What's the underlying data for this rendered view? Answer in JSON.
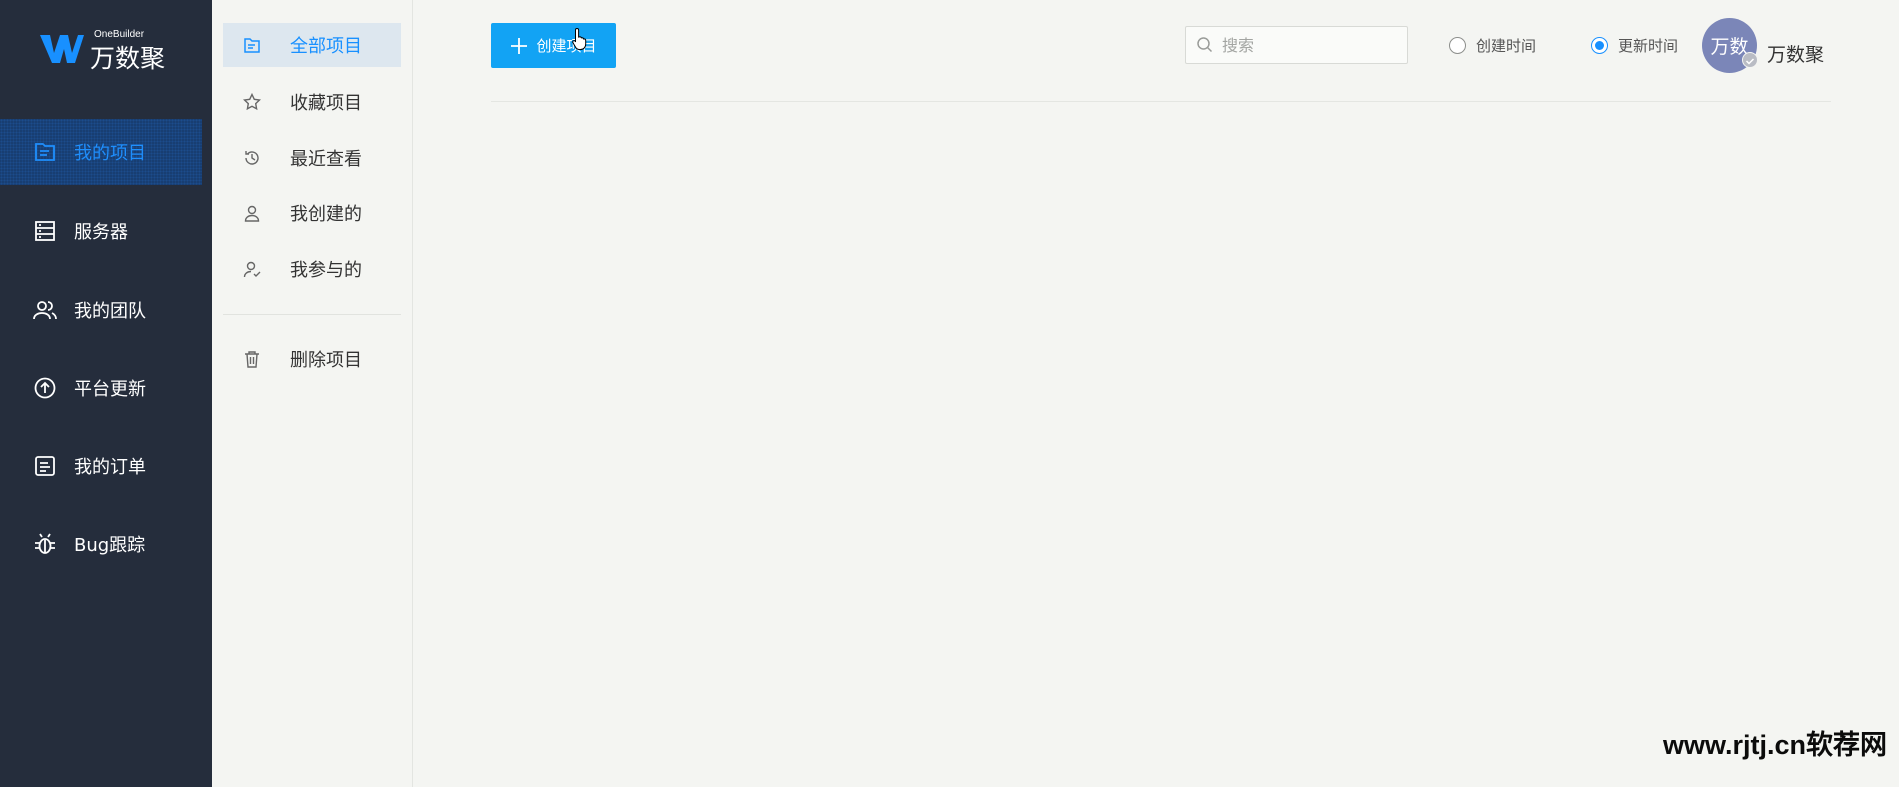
{
  "brand": {
    "name_en": "OneBuilder",
    "name_cn": "万数聚",
    "accent": "#1890ff",
    "sidebar_bg": "#252d3c"
  },
  "sidebar": {
    "items": [
      {
        "label": "我的项目",
        "icon": "folder-icon",
        "active": true
      },
      {
        "label": "服务器",
        "icon": "server-icon",
        "active": false
      },
      {
        "label": "我的团队",
        "icon": "team-icon",
        "active": false
      },
      {
        "label": "平台更新",
        "icon": "upload-circle-icon",
        "active": false
      },
      {
        "label": "我的订单",
        "icon": "order-icon",
        "active": false
      },
      {
        "label": "Bug跟踪",
        "icon": "bug-icon",
        "active": false
      }
    ]
  },
  "subnav": {
    "items": [
      {
        "label": "全部项目",
        "icon": "folder-icon",
        "active": true
      },
      {
        "label": "收藏项目",
        "icon": "star-icon",
        "active": false
      },
      {
        "label": "最近查看",
        "icon": "history-icon",
        "active": false
      },
      {
        "label": "我创建的",
        "icon": "user-icon",
        "active": false
      },
      {
        "label": "我参与的",
        "icon": "user-check-icon",
        "active": false
      }
    ],
    "trash": {
      "label": "删除项目",
      "icon": "trash-icon"
    }
  },
  "toolbar": {
    "create_label": "创建项目",
    "search_placeholder": "搜索",
    "sort_options": [
      {
        "label": "创建时间",
        "checked": false
      },
      {
        "label": "更新时间",
        "checked": true
      }
    ]
  },
  "user": {
    "avatar_text": "万数",
    "name": "万数聚"
  },
  "watermark": "www.rjtj.cn软荐网"
}
